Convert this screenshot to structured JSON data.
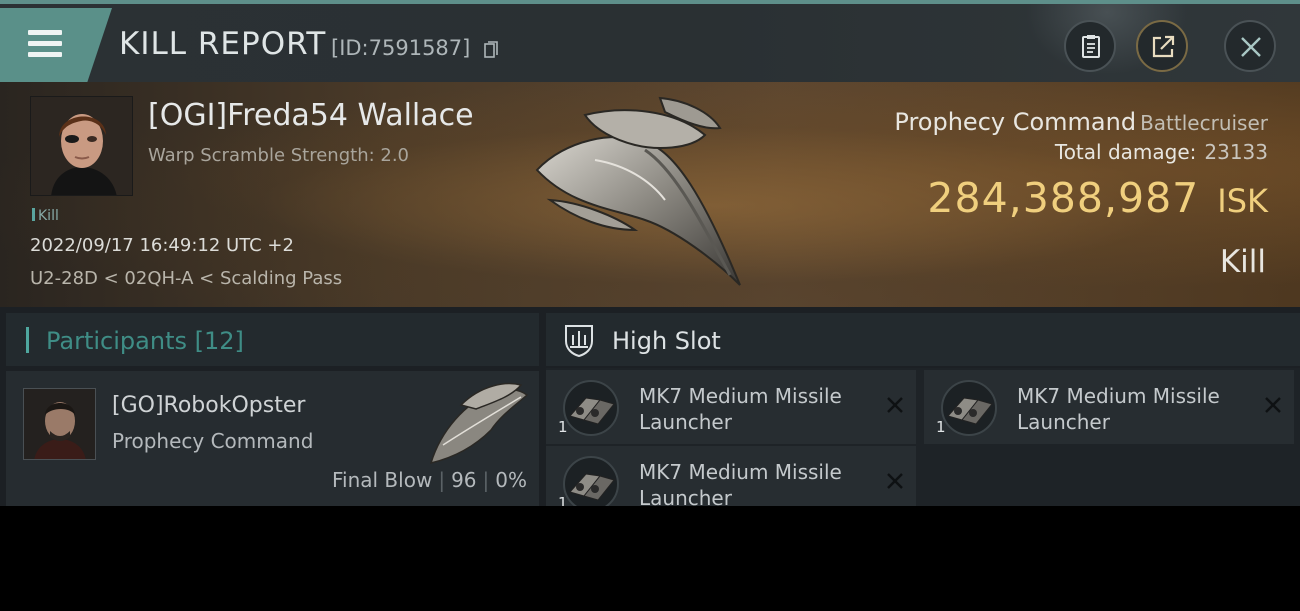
{
  "header": {
    "title": "KILL REPORT",
    "id_text": "[ID:7591587]",
    "icons": {
      "menu": "hamburger-menu-icon",
      "copy": "copy-icon",
      "clipboard": "clipboard-icon",
      "share": "share-icon",
      "close": "close-icon"
    }
  },
  "victim": {
    "name": "[OGI]Freda54 Wallace",
    "warp_scramble": "Warp Scramble Strength: 2.0",
    "kill_tag": "Kill",
    "datetime": "2022/09/17 16:49:12 UTC +2",
    "location": "U2-28D < 02QH-A < Scalding Pass",
    "ship_name": "Prophecy Command",
    "ship_class": "Battlecruiser",
    "total_damage_label": "Total damage:",
    "total_damage": "23133",
    "isk_value": "284,388,987",
    "isk_unit": "ISK",
    "result": "Kill"
  },
  "participants": {
    "title": "Participants [12]",
    "items": [
      {
        "name": "[GO]RobokOpster",
        "ship": "Prophecy Command",
        "blow": "Final Blow",
        "damage": "96",
        "percent": "0%"
      }
    ]
  },
  "high_slot": {
    "title": "High Slot",
    "items": [
      {
        "qty": "1",
        "name": "MK7 Medium Missile Launcher"
      },
      {
        "qty": "1",
        "name": "MK7 Medium Missile Launcher"
      },
      {
        "qty": "1",
        "name": "MK7 Medium Missile Launcher"
      }
    ]
  },
  "colors": {
    "accent_teal": "#5a9089",
    "isk_gold": "#f0cf7e",
    "panel": "#262c30"
  }
}
